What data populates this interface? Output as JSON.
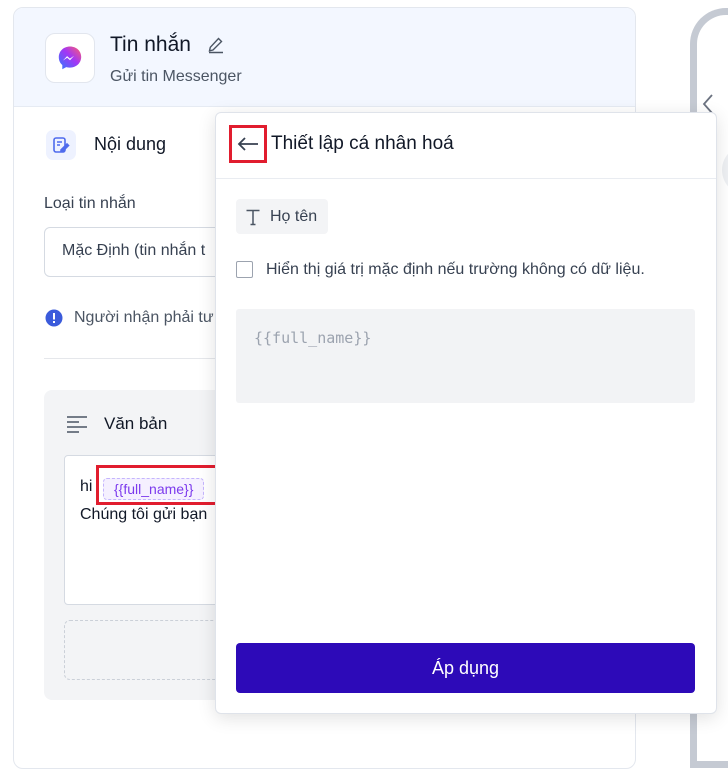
{
  "node": {
    "title": "Tin nhắn",
    "subtitle": "Gửi tin Messenger",
    "app_icon": "messenger-icon",
    "edit_icon": "pencil-icon"
  },
  "content": {
    "section_title": "Nội dung",
    "message_type_label": "Loại tin nhắn",
    "message_type_value": "Mặc Định (tin nhắn t",
    "notice_text": "Người nhận phải tư",
    "text_block": {
      "title": "Văn bản",
      "line1_prefix": "hi",
      "tag": "{{full_name}}",
      "line2": "Chúng tôi gửi bạn"
    }
  },
  "personalize_popup": {
    "title": "Thiết lập cá nhân hoá",
    "field_label": "Họ tên",
    "checkbox_label": "Hiển thị giá trị mặc định nếu trường không có dữ liệu.",
    "checkbox_checked": false,
    "default_value_placeholder": "{{full_name}}",
    "apply_label": "Áp dụng"
  },
  "colors": {
    "primary_button": "#2d0ab8",
    "highlight": "#e11d2e",
    "tag_text": "#7c3aed",
    "header_bg": "#f3f7ff"
  }
}
